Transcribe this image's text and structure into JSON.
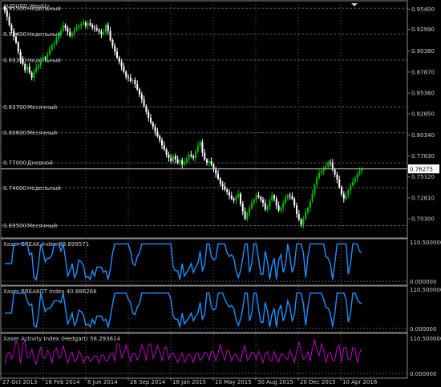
{
  "colors": {
    "background": "#000000",
    "grid": "#5a5a5a",
    "frame": "#8a8a8a",
    "text": "#cfcfcf",
    "candle_up": "#00c000",
    "candle_down": "#ffffff",
    "break_line": "#1e90ff",
    "activity_line": "#c000c0",
    "current_price_box": "#ffffff"
  },
  "header": {
    "symbol_label": "AUDUSD,Weekly",
    "dropdown_icon": "triangle-down-icon"
  },
  "main_panel": {
    "price_axis": [
      "0.95400",
      "0.92990",
      "0.90380",
      "0.87870",
      "0.85360",
      "0.82850",
      "0.80340",
      "0.77830",
      "0.75320",
      "0.72810",
      "0.70300"
    ],
    "current_price": "0.76275",
    "levels": [
      {
        "price": "0.95500",
        "label": "Недельный"
      },
      {
        "price": "0.92400",
        "label": "Недельный"
      },
      {
        "price": "0.89300",
        "label": "Недельный"
      },
      {
        "price": "0.83700",
        "label": "Месячный"
      },
      {
        "price": "0.80600",
        "label": "Месячный"
      },
      {
        "price": "0.77000",
        "label": "Дневной"
      },
      {
        "price": "0.74000",
        "label": "Недельный"
      },
      {
        "price": "0.69500",
        "label": "Месячный"
      }
    ]
  },
  "indicators": [
    {
      "title": "Xaser BREAK Index 69.899571",
      "axis_top": "110.500000",
      "axis_bottom": "0.000000"
    },
    {
      "title": "Xaser BREAKOT Index 40.886268",
      "axis_top": "110.500000",
      "axis_bottom": "0.000000"
    },
    {
      "title": "Xaser Activity Index (Hedgart) 58.293614",
      "axis_top": "110.500000",
      "axis_bottom": "0.000000"
    }
  ],
  "time_axis": [
    "27 Oct 2013",
    "16 Feb 2014",
    "8 Jun 2014",
    "28 Sep 2014",
    "18 Jan 2015",
    "10 May 2015",
    "30 Aug 2015",
    "20 Dec 2015",
    "10 Apr 2016"
  ],
  "chart_data": {
    "type": "candlestick",
    "timeframe": "Weekly",
    "y_range": [
      0.682,
      0.962
    ],
    "closes": [
      0.952,
      0.945,
      0.935,
      0.928,
      0.921,
      0.914,
      0.903,
      0.893,
      0.888,
      0.881,
      0.885,
      0.878,
      0.872,
      0.879,
      0.884,
      0.887,
      0.893,
      0.896,
      0.895,
      0.9,
      0.906,
      0.911,
      0.913,
      0.918,
      0.924,
      0.928,
      0.935,
      0.931,
      0.927,
      0.922,
      0.925,
      0.929,
      0.932,
      0.934,
      0.936,
      0.938,
      0.934,
      0.937,
      0.935,
      0.932,
      0.931,
      0.929,
      0.927,
      0.924,
      0.926,
      0.935,
      0.928,
      0.917,
      0.91,
      0.903,
      0.896,
      0.891,
      0.885,
      0.879,
      0.873,
      0.872,
      0.868,
      0.869,
      0.864,
      0.858,
      0.852,
      0.846,
      0.838,
      0.831,
      0.824,
      0.818,
      0.813,
      0.807,
      0.802,
      0.797,
      0.791,
      0.786,
      0.78,
      0.776,
      0.772,
      0.778,
      0.774,
      0.77,
      0.773,
      0.768,
      0.771,
      0.775,
      0.78,
      0.778,
      0.776,
      0.783,
      0.79,
      0.795,
      0.782,
      0.774,
      0.77,
      0.772,
      0.768,
      0.762,
      0.757,
      0.751,
      0.745,
      0.742,
      0.738,
      0.735,
      0.731,
      0.727,
      0.725,
      0.729,
      0.733,
      0.721,
      0.712,
      0.703,
      0.71,
      0.716,
      0.722,
      0.726,
      0.731,
      0.729,
      0.726,
      0.722,
      0.714,
      0.718,
      0.725,
      0.731,
      0.727,
      0.719,
      0.713,
      0.716,
      0.722,
      0.728,
      0.731,
      0.73,
      0.727,
      0.719,
      0.709,
      0.702,
      0.696,
      0.703,
      0.711,
      0.716,
      0.724,
      0.733,
      0.744,
      0.752,
      0.758,
      0.76,
      0.763,
      0.766,
      0.771,
      0.77,
      0.762,
      0.756,
      0.75,
      0.741,
      0.733,
      0.727,
      0.731,
      0.737,
      0.743,
      0.747,
      0.752,
      0.756,
      0.76,
      0.763
    ]
  }
}
